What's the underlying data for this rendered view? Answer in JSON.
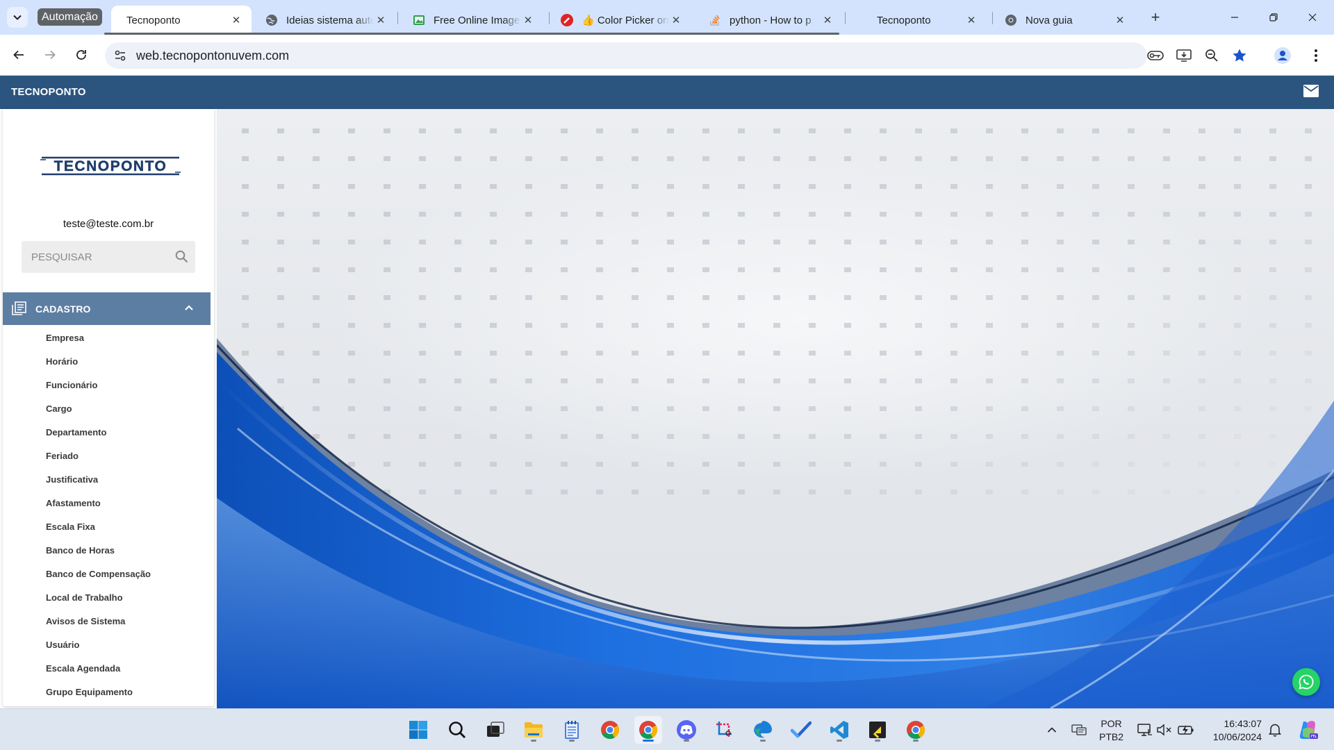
{
  "browser": {
    "tab_group_label": "Automação",
    "tabs": [
      {
        "title": "Tecnoponto",
        "active": true,
        "icon": "no-favicon"
      },
      {
        "title": "Ideias sistema auto",
        "active": false,
        "icon": "globe-icon"
      },
      {
        "title": "Free Online Image",
        "active": false,
        "icon": "image-editor-icon"
      },
      {
        "title": "👍 Color Picker on",
        "active": false,
        "icon": "color-picker-icon"
      },
      {
        "title": "python - How to p",
        "active": false,
        "icon": "stackoverflow-icon"
      },
      {
        "title": "Tecnoponto",
        "active": false,
        "icon": "no-favicon"
      },
      {
        "title": "Nova guia",
        "active": false,
        "icon": "chrome-icon"
      }
    ],
    "url": "web.tecnopontonuvem.com"
  },
  "app": {
    "brand": "TECNOPONTO",
    "logo_text": "TECNOPONTO",
    "user_email": "teste@teste.com.br",
    "search_placeholder": "PESQUISAR",
    "menu": {
      "section": "CADASTRO",
      "expanded": true,
      "items": [
        "Empresa",
        "Horário",
        "Funcionário",
        "Cargo",
        "Departamento",
        "Feriado",
        "Justificativa",
        "Afastamento",
        "Escala Fixa",
        "Banco de Horas",
        "Banco de Compensação",
        "Local de Trabalho",
        "Avisos de Sistema",
        "Usuário",
        "Escala Agendada",
        "Grupo Equipamento"
      ]
    }
  },
  "colors": {
    "header": "#2b557f",
    "menu_section": "#5d7ea3",
    "whatsapp": "#25d366",
    "tabstrip": "#d3e3fd"
  },
  "taskbar": {
    "apps": [
      "windows-start-icon",
      "search-icon",
      "task-view-icon",
      "file-explorer-icon",
      "notepad-icon",
      "chrome-icon",
      "chrome-icon",
      "discord-icon",
      "snipping-tool-icon",
      "edge-icon",
      "todo-icon",
      "vscode-icon",
      "sticky-notes-icon",
      "chrome-icon"
    ],
    "language_line1": "POR",
    "language_line2": "PTB2",
    "time": "16:43:07",
    "date": "10/06/2024"
  }
}
